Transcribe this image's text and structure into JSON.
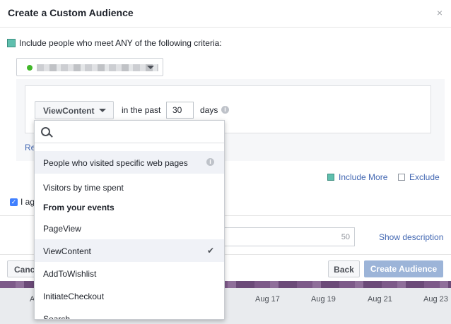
{
  "modal": {
    "title": "Create a Custom Audience",
    "close": "×"
  },
  "criteria": {
    "text": "Include people who meet ANY of the following criteria:"
  },
  "rule": {
    "event_selected": "ViewContent",
    "in_the_past": "in the past",
    "days_value": "30",
    "days_label": "days",
    "partial_link": "Re"
  },
  "actions": {
    "include_more": "Include More",
    "exclude": "Exclude"
  },
  "agree": {
    "partial_text": "I ag"
  },
  "description": {
    "char_limit": "50",
    "show_description": "Show description"
  },
  "footer": {
    "cancel": "Cancel",
    "back": "Back",
    "create": "Create Audience"
  },
  "dropdown": {
    "search_placeholder": "",
    "items": [
      {
        "label": "People who visited specific web pages"
      },
      {
        "label": "Visitors by time spent"
      },
      {
        "header": "From your events"
      },
      {
        "label": "PageView"
      },
      {
        "label": "ViewContent",
        "selected": true
      },
      {
        "label": "AddToWishlist"
      },
      {
        "label": "InitiateCheckout"
      },
      {
        "label": "Search"
      }
    ]
  },
  "background": {
    "dates": [
      "Aug 17",
      "Aug 19",
      "Aug 21",
      "Aug 23"
    ],
    "partial_date": "A"
  },
  "colors": {
    "link": "#4267b2",
    "primary_disabled": "#9cb4d8",
    "include_icon": "#5fbfae",
    "status_dot": "#42b72a"
  }
}
